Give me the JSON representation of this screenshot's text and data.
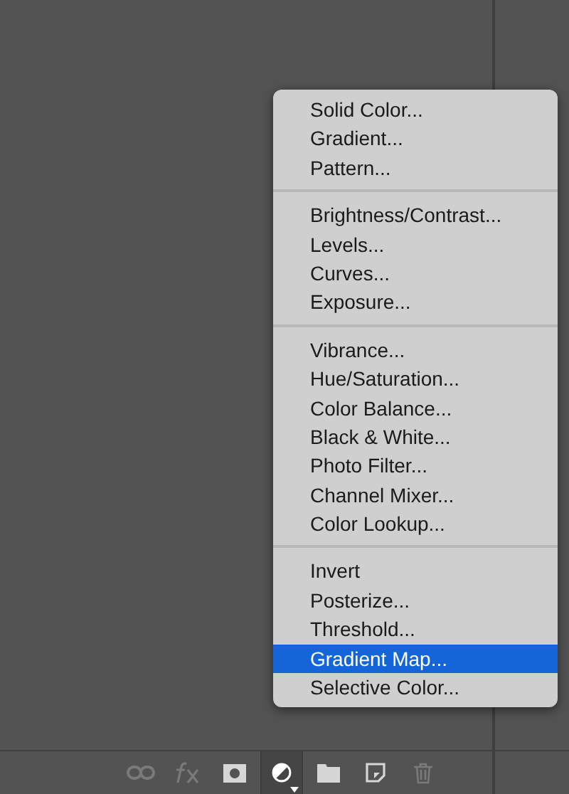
{
  "menu": {
    "groups": [
      {
        "items": [
          {
            "label": "Solid Color...",
            "selected": false
          },
          {
            "label": "Gradient...",
            "selected": false
          },
          {
            "label": "Pattern...",
            "selected": false
          }
        ]
      },
      {
        "items": [
          {
            "label": "Brightness/Contrast...",
            "selected": false
          },
          {
            "label": "Levels...",
            "selected": false
          },
          {
            "label": "Curves...",
            "selected": false
          },
          {
            "label": "Exposure...",
            "selected": false
          }
        ]
      },
      {
        "items": [
          {
            "label": "Vibrance...",
            "selected": false
          },
          {
            "label": "Hue/Saturation...",
            "selected": false
          },
          {
            "label": "Color Balance...",
            "selected": false
          },
          {
            "label": "Black & White...",
            "selected": false
          },
          {
            "label": "Photo Filter...",
            "selected": false
          },
          {
            "label": "Channel Mixer...",
            "selected": false
          },
          {
            "label": "Color Lookup...",
            "selected": false
          }
        ]
      },
      {
        "items": [
          {
            "label": "Invert",
            "selected": false
          },
          {
            "label": "Posterize...",
            "selected": false
          },
          {
            "label": "Threshold...",
            "selected": false
          },
          {
            "label": "Gradient Map...",
            "selected": true
          },
          {
            "label": "Selective Color...",
            "selected": false
          }
        ]
      }
    ]
  },
  "toolbar": [
    {
      "kind": "link",
      "disabled": true,
      "active": false
    },
    {
      "kind": "fx",
      "disabled": true,
      "active": false
    },
    {
      "kind": "mask",
      "disabled": false,
      "active": false
    },
    {
      "kind": "adjustment",
      "disabled": false,
      "active": true
    },
    {
      "kind": "folder",
      "disabled": false,
      "active": false
    },
    {
      "kind": "new",
      "disabled": false,
      "active": false
    },
    {
      "kind": "trash",
      "disabled": true,
      "active": false
    }
  ]
}
